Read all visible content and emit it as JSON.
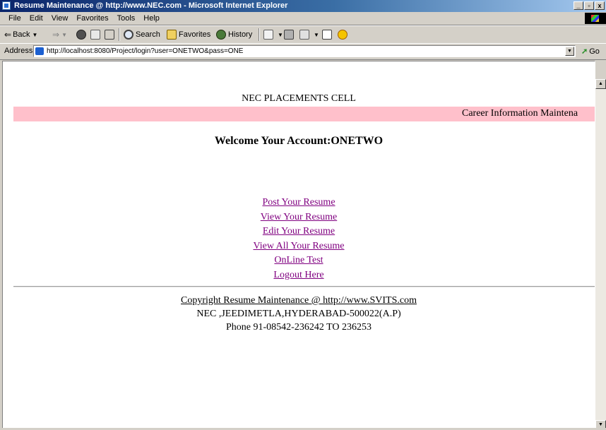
{
  "window": {
    "title": "Resume Maintenance @ http://www.NEC.com - Microsoft Internet Explorer",
    "controls": [
      "_",
      "▫",
      "x"
    ]
  },
  "menu": [
    "File",
    "Edit",
    "View",
    "Favorites",
    "Tools",
    "Help"
  ],
  "toolbar": {
    "back": "Back",
    "search": "Search",
    "favorites": "Favorites",
    "history": "History"
  },
  "address": {
    "label": "Address",
    "url": "http://localhost:8080/Project/login?user=ONETWO&pass=ONE",
    "go": "Go"
  },
  "page": {
    "site_title": "NEC PLACEMENTS CELL",
    "marquee": "Career Information Maintena",
    "welcome": "Welcome Your Account:ONETWO",
    "links": [
      "Post Your Resume",
      "View Your Resume",
      "Edit Your Resume",
      "View All Your Resume",
      "OnLine Test",
      "Logout Here"
    ],
    "footer": {
      "copyright": "Copyright Resume Maintenance @ http://www.SVITS.com",
      "address": "NEC ,JEEDIMETLA,HYDERABAD-500022(A.P)",
      "phone": "Phone 91-08542-236242 TO 236253"
    }
  },
  "colors": {
    "title_bar": "#0a246a",
    "marquee_bg": "#ffc0cb",
    "link": "#800080"
  }
}
